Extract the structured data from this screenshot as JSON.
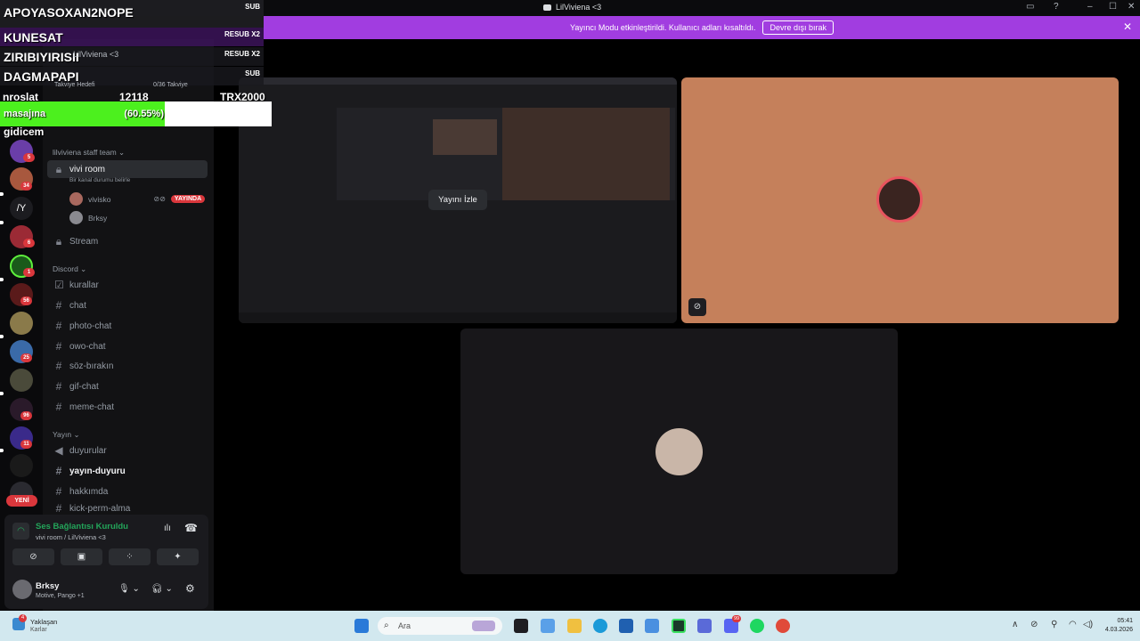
{
  "window": {
    "title": "LilViviena <3"
  },
  "banner": {
    "text": "Yayıncı Modu etkinleştirildi. Kullanıcı adları kısaltıldı.",
    "button": "Devre dışı bırak"
  },
  "overlay": {
    "rows": [
      {
        "name": "APOYASOXAN2NOPE",
        "tag": "SUB"
      },
      {
        "name": "KUNESAT",
        "tag": ""
      },
      {
        "name": "ZIRIBIYIRISII",
        "tag": "RESUB X2"
      },
      {
        "name": "DAGMAPAPI",
        "tag": "SUB"
      }
    ],
    "resub_tag_1": "RESUB X2",
    "server_name": "LilViviena <3",
    "boost_goal_label": "Takviye Hedefi",
    "boost_count": "0/36 Takviye",
    "stat_left": "nroslat",
    "stat_mid": "12118",
    "stat_right": "TRX2000",
    "goal_label": "masajına",
    "goal_percent": "(60.55%)",
    "goal_fraction": 0.6055,
    "footer": "gidicem"
  },
  "guilds": {
    "badges": [
      "5",
      "34",
      "6",
      "1",
      "56",
      "25",
      "96",
      "11"
    ],
    "text_icon": "/Y",
    "yeni": "YENİ"
  },
  "channels": {
    "categories": {
      "staff": "lilviviena staff team",
      "discord": "Discord",
      "yayin": "Yayın"
    },
    "voice_room": "vivi room",
    "voice_status": "Bir kanal durumu belirle",
    "voice_users": [
      {
        "name": "vivisko",
        "live": "YAYINDA"
      },
      {
        "name": "Brksy",
        "live": ""
      }
    ],
    "stream": "Stream",
    "discord_channels": [
      "kurallar",
      "chat",
      "photo-chat",
      "owo-chat",
      "söz-bırakın",
      "gif-chat",
      "meme-chat"
    ],
    "yayin_channels": [
      "duyurular",
      "yayın-duyuru",
      "hakkımda",
      "kick-perm-alma"
    ]
  },
  "voice_panel": {
    "status": "Ses Bağlantısı Kuruldu",
    "location": "vivi room / LilViviena <3",
    "username": "Brksy",
    "user_status": "Motive, Pango +1"
  },
  "stage": {
    "watch_button": "Yayını İzle"
  },
  "taskbar": {
    "weather_title": "Yaklaşan",
    "weather_sub": "Karlar",
    "weather_badge": "4",
    "search_placeholder": "Ara",
    "discord_badge": "99",
    "time": "05:41",
    "date": "4.03.2026"
  }
}
